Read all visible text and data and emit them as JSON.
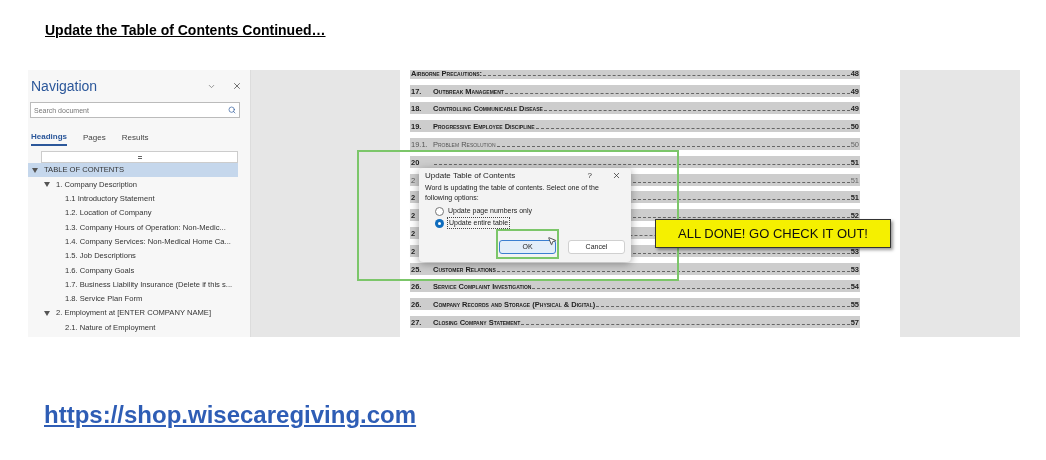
{
  "heading": "Update the Table of Contents Continued…",
  "navigation": {
    "title": "Navigation",
    "search": {
      "placeholder": "Search document"
    },
    "tabs": [
      {
        "label": "Headings",
        "selected": true
      },
      {
        "label": "Pages",
        "selected": false
      },
      {
        "label": "Results",
        "selected": false
      }
    ],
    "tree": [
      {
        "label": "TABLE OF CONTENTS",
        "selected": true,
        "expanded": true,
        "children": [
          {
            "label": "1. Company Description",
            "selected": false,
            "expanded": true,
            "children": [
              {
                "label": "1.1 Introductory Statement",
                "selected": false
              },
              {
                "label": "1.2. Location of Company",
                "selected": false
              },
              {
                "label": "1.3. Company Hours of Operation: Non-Medic...",
                "selected": false
              },
              {
                "label": "1.4. Company Services: Non-Medical Home Ca...",
                "selected": false
              },
              {
                "label": "1.5. Job Descriptions",
                "selected": false
              },
              {
                "label": "1.6. Company Goals",
                "selected": false
              },
              {
                "label": "1.7. Business Liability Insurance (Delete if this s...",
                "selected": false
              },
              {
                "label": "1.8. Service Plan Form",
                "selected": false
              }
            ]
          },
          {
            "label": "2. Employment at [ENTER COMPANY NAME]",
            "selected": false,
            "expanded": true,
            "children": [
              {
                "label": "2.1. Nature of Employment",
                "selected": false
              }
            ]
          }
        ]
      }
    ]
  },
  "toc": [
    {
      "kind": "main",
      "title": "Airborne Precautions:",
      "page": "48"
    },
    {
      "kind": "main",
      "number": "17.",
      "title": "Outbreak Management",
      "page": "49"
    },
    {
      "kind": "main",
      "number": "18.",
      "title": "Controlling Communicable Disease",
      "page": "49"
    },
    {
      "kind": "main",
      "number": "19.",
      "title": "Progressive Employee Discipline",
      "page": "50"
    },
    {
      "kind": "sub",
      "number": "19.1.",
      "title": "Problem Resolution",
      "page": "50"
    },
    {
      "kind": "main",
      "number": "20",
      "page": "51"
    },
    {
      "kind": "sub",
      "number": "2",
      "page": "51"
    },
    {
      "kind": "main",
      "number": "2",
      "page": "51"
    },
    {
      "kind": "main",
      "number": "2",
      "page": "52"
    },
    {
      "kind": "main",
      "number": "2"
    },
    {
      "kind": "main",
      "number": "2",
      "page": "53"
    },
    {
      "kind": "main",
      "number": "25.",
      "title": "Customer Relations",
      "page": "53"
    },
    {
      "kind": "main",
      "number": "26.",
      "title": "Service Complaint Investigation",
      "page": "54"
    },
    {
      "kind": "main",
      "number": "26.",
      "title": "Company Records and Storage (Physical & Digital)",
      "page": "55"
    },
    {
      "kind": "main",
      "number": "27.",
      "title": "Closing Company Statement",
      "page": "57"
    }
  ],
  "dialog": {
    "title": "Update Table of Contents",
    "help": "?",
    "message": "Word is updating the table of contents.  Select one of the following options:",
    "options": [
      {
        "label": "Update page numbers only",
        "selected": false
      },
      {
        "label": "Update entire table",
        "selected": true
      }
    ],
    "buttons": [
      {
        "label": "OK",
        "default": true
      },
      {
        "label": "Cancel",
        "default": false
      }
    ]
  },
  "callout": "ALL DONE! GO CHECK IT OUT!",
  "link": "https://shop.wisecaregiving.com"
}
